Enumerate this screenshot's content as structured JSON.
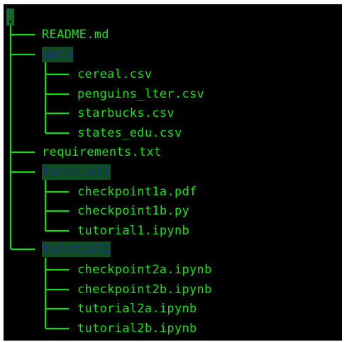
{
  "tree": {
    "root": ".",
    "items": [
      {
        "name": "README.md",
        "type": "file"
      },
      {
        "name": "data",
        "type": "directory"
      },
      {
        "name": "cereal.csv",
        "type": "file"
      },
      {
        "name": "penguins_lter.csv",
        "type": "file"
      },
      {
        "name": "starbucks.csv",
        "type": "file"
      },
      {
        "name": "states_edu.csv",
        "type": "file"
      },
      {
        "name": "requirements.txt",
        "type": "file"
      },
      {
        "name": "tutorial1",
        "type": "directory"
      },
      {
        "name": "checkpoint1a.pdf",
        "type": "file"
      },
      {
        "name": "checkpoint1b.py",
        "type": "file"
      },
      {
        "name": "tutorial1.ipynb",
        "type": "file"
      },
      {
        "name": "tutorial2",
        "type": "directory"
      },
      {
        "name": "checkpoint2a.ipynb",
        "type": "file"
      },
      {
        "name": "checkpoint2b.ipynb",
        "type": "file"
      },
      {
        "name": "tutorial2a.ipynb",
        "type": "file"
      },
      {
        "name": "tutorial2b.ipynb",
        "type": "file"
      }
    ]
  },
  "colors": {
    "background": "#000000",
    "text": "#16e016",
    "directory_highlight": "#0f4d24",
    "directory_text": "#1d2f8a"
  }
}
